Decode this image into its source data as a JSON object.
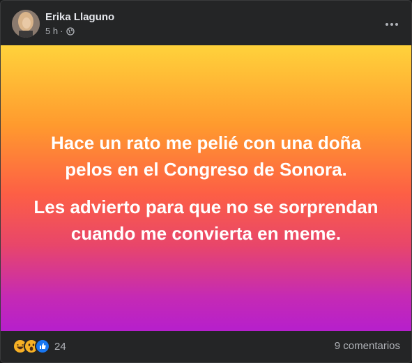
{
  "post": {
    "author_name": "Erika Llaguno",
    "time": "5 h",
    "separator": "·",
    "privacy_icon": "globe-icon",
    "menu_icon": "more-options-icon",
    "background_gradient": [
      "#ffd23b",
      "#ff9a2e",
      "#fd5f45",
      "#e8466a",
      "#b61fcc"
    ],
    "text_lines": [
      "Hace un rato me pelié con una doña pelos en el Congreso de Sonora.",
      "Les advierto para que no se sorprendan cuando me convierta en meme."
    ]
  },
  "footer": {
    "reaction_icons": [
      "haha-icon",
      "wow-icon",
      "like-icon"
    ],
    "reaction_count": "24",
    "comments": "9 comentarios"
  },
  "colors": {
    "card_bg": "#242526",
    "text_primary": "#e4e6eb",
    "text_secondary": "#b0b3b8",
    "like_blue": "#1877f2",
    "emoji_yellow": "#f7b125"
  }
}
